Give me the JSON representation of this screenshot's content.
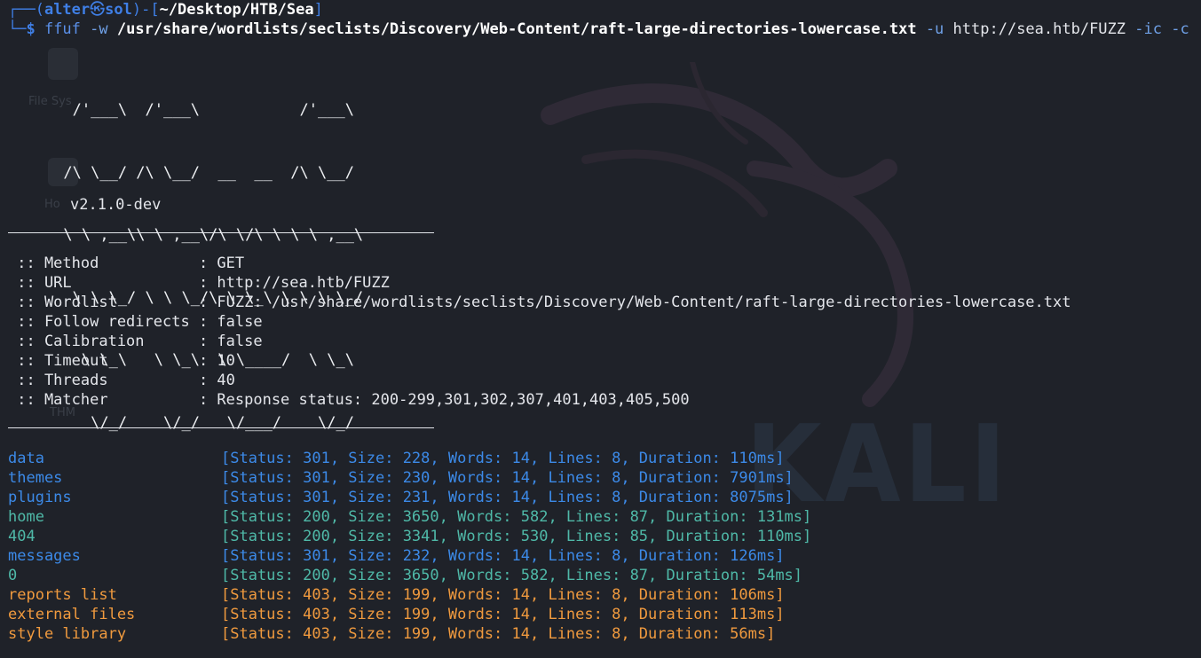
{
  "prompt": {
    "corner": "┌──(",
    "user": "alter",
    "at_symbol": "㉿",
    "host": "sol",
    "mid": ")-[",
    "cwd": "~/Desktop/HTB/Sea",
    "end": "]",
    "line2_prefix": "└─$ "
  },
  "command": {
    "program": "ffuf",
    "flag_w": "-w",
    "wordlist": "/usr/share/wordlists/seclists/Discovery/Web-Content/raft-large-directories-lowercase.txt",
    "flag_u": "-u",
    "url": "http://sea.htb/FUZZ",
    "flag_ic": "-ic",
    "flag_c": "-c"
  },
  "banner": {
    "art": [
      "       /'___\\  /'___\\           /'___\\",
      "      /\\ \\__/ /\\ \\__/  __  __  /\\ \\__/",
      "      \\ \\ ,__\\\\ \\ ,__\\/\\ \\/\\ \\ \\ \\ ,__\\",
      "       \\ \\ \\_/ \\ \\ \\_/\\ \\ \\_\\ \\ \\ \\ \\_/",
      "        \\ \\_\\   \\ \\_\\  \\ \\____/  \\ \\_\\",
      "         \\/_/    \\/_/   \\/___/    \\/_/"
    ],
    "version": "v2.1.0-dev"
  },
  "config": [
    {
      "key": " :: Method           ",
      "value": ": GET"
    },
    {
      "key": " :: URL              ",
      "value": ": http://sea.htb/FUZZ"
    },
    {
      "key": " :: Wordlist         ",
      "value": ": FUZZ: /usr/share/wordlists/seclists/Discovery/Web-Content/raft-large-directories-lowercase.txt"
    },
    {
      "key": " :: Follow redirects ",
      "value": ": false"
    },
    {
      "key": " :: Calibration      ",
      "value": ": false"
    },
    {
      "key": " :: Timeout          ",
      "value": ": 10"
    },
    {
      "key": " :: Threads          ",
      "value": ": 40"
    },
    {
      "key": " :: Matcher          ",
      "value": ": Response status: 200-299,301,302,307,401,403,405,500"
    }
  ],
  "results": [
    {
      "name": "data",
      "status": "[Status: 301, Size: 228, Words: 14, Lines: 8, Duration: 110ms]",
      "status_code": 301
    },
    {
      "name": "themes",
      "status": "[Status: 301, Size: 230, Words: 14, Lines: 8, Duration: 7901ms]",
      "status_code": 301
    },
    {
      "name": "plugins",
      "status": "[Status: 301, Size: 231, Words: 14, Lines: 8, Duration: 8075ms]",
      "status_code": 301
    },
    {
      "name": "home",
      "status": "[Status: 200, Size: 3650, Words: 582, Lines: 87, Duration: 131ms]",
      "status_code": 200
    },
    {
      "name": "404",
      "status": "[Status: 200, Size: 3341, Words: 530, Lines: 85, Duration: 110ms]",
      "status_code": 200
    },
    {
      "name": "messages",
      "status": "[Status: 301, Size: 232, Words: 14, Lines: 8, Duration: 126ms]",
      "status_code": 301
    },
    {
      "name": "0",
      "status": "[Status: 200, Size: 3650, Words: 582, Lines: 87, Duration: 54ms]",
      "status_code": 200
    },
    {
      "name": "reports list",
      "status": "[Status: 403, Size: 199, Words: 14, Lines: 8, Duration: 106ms]",
      "status_code": 403
    },
    {
      "name": "external files",
      "status": "[Status: 403, Size: 199, Words: 14, Lines: 8, Duration: 113ms]",
      "status_code": 403
    },
    {
      "name": "style library",
      "status": "[Status: 403, Size: 199, Words: 14, Lines: 8, Duration: 56ms]",
      "status_code": 403
    }
  ],
  "colors": {
    "background": "#1f2229",
    "status_301": "#3c8ae8",
    "status_200": "#4fb9a8",
    "status_403": "#f09a3e"
  },
  "desktop_ghost": {
    "icon1_label": "File Sys",
    "icon2_label": "Ho",
    "icon3_label": "THM"
  }
}
